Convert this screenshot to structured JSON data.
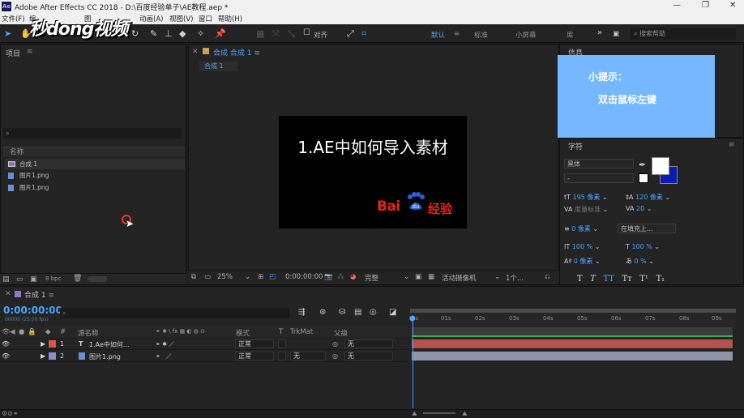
{
  "window": {
    "title": "Adobe After Effects CC 2018 - D:\\百度经验单子\\AE教程.aep *",
    "controls": [
      "—",
      "❐",
      "✕"
    ]
  },
  "menu": [
    "文件(F)",
    "编",
    "图",
    "动画(A)",
    "视图(V)",
    "窗口",
    "帮助(H)"
  ],
  "watermark": "秒dong视频",
  "toolbar": {
    "align_label": "对齐",
    "workspaces": [
      "默认",
      "标准",
      "小屏幕",
      "库"
    ],
    "more": "»",
    "search_placeholder": "搜索帮助"
  },
  "project": {
    "title": "项目",
    "search_placeholder": "",
    "column_name": "名称",
    "items": [
      {
        "name": "合成 1",
        "type": "comp"
      },
      {
        "name": "图片1.png",
        "type": "image"
      },
      {
        "name": "图片1.png",
        "type": "image"
      }
    ],
    "bpc": "8 bpc"
  },
  "composition": {
    "panel_title": "合成 合成 1",
    "tab_label": "合成 1",
    "zoom": "25%",
    "timecode": "0:00:00:00",
    "resolution": "完整",
    "camera": "活动摄像机",
    "views": "1个..."
  },
  "slide": {
    "title": "1.AE中如何导入素材",
    "logo_bai": "Bai",
    "logo_du": "du",
    "logo_jingyan": "经验"
  },
  "info_panel": {
    "title": "信息",
    "tip_title": "小提示：",
    "tip_body": "双击鼠标左键"
  },
  "character": {
    "title": "字符",
    "font": "黑体",
    "style": "-",
    "size": "195 像素",
    "leading": "120 像素",
    "kerning": "度量标准",
    "tracking": "20",
    "stroke_width": "0 像素",
    "stroke_type": "在填充上...",
    "vscale": "100 %",
    "hscale": "100 %",
    "baseline": "0 像素",
    "tsume": "0 %",
    "styles": [
      "T",
      "T",
      "TT",
      "Tт",
      "T¹",
      "T₁"
    ]
  },
  "timeline": {
    "tab": "合成 1",
    "timecode": "0:00:00:00",
    "timecode_sub": "00000 (25.00 fps)",
    "columns": {
      "source_name": "源名称",
      "mode": "模式",
      "t": "T",
      "trkmat": "TrkMat",
      "parent": "父级"
    },
    "layers": [
      {
        "num": "1",
        "type": "T",
        "name": "1.Ae中如何...",
        "mode": "正常",
        "trkmat": "",
        "parent": "无",
        "color": "#d9534f"
      },
      {
        "num": "2",
        "type": "img",
        "name": "图片1.png",
        "mode": "正常",
        "trkmat": "无",
        "parent": "无",
        "color": "#8a8fd0"
      }
    ],
    "ruler_ticks": [
      "0s",
      "01s",
      "02s",
      "03s",
      "04s",
      "05s",
      "06s",
      "07s",
      "08s",
      "09s"
    ]
  },
  "colors": {
    "accent": "#4aa3ff",
    "layer1_bar": "#b5524d",
    "layer2_bar": "#8e95a6",
    "tip_bg": "#76b8ff"
  }
}
